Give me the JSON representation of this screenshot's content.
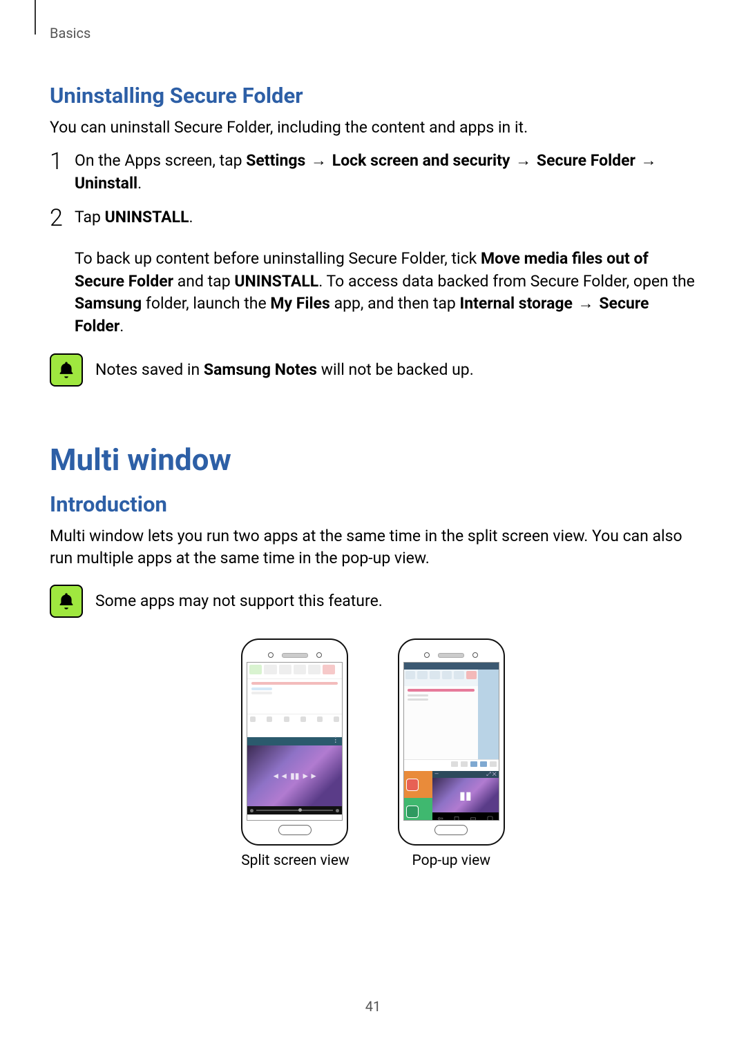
{
  "header": {
    "section_label": "Basics"
  },
  "section1": {
    "heading": "Uninstalling Secure Folder",
    "intro": "You can uninstall Secure Folder, including the content and apps in it.",
    "step1": {
      "num": "1",
      "t1": "On the Apps screen, tap",
      "b1": "Settings",
      "arrow": "→",
      "b2": "Lock screen and security",
      "b3": "Secure Folder",
      "b4": "Uninstall",
      "period": "."
    },
    "step2": {
      "num": "2",
      "t1": "Tap",
      "b1": "UNINSTALL",
      "period": ".",
      "p2a": "To back up content before uninstalling Secure Folder, tick",
      "p2b": "Move media files out of Secure Folder",
      "p2c": "and tap",
      "p2d": "UNINSTALL",
      "p2e": ". To access data backed from Secure Folder, open the",
      "p2f": "Samsung",
      "p2g": "folder, launch the",
      "p2h": "My Files",
      "p2i": "app, and then tap",
      "p2j": "Internal storage",
      "p2k": "Secure Folder",
      "p2l": "."
    },
    "note": {
      "t1": "Notes saved in",
      "b1": "Samsung Notes",
      "t2": "will not be backed up."
    }
  },
  "section2": {
    "chapter": "Multi window",
    "sub_heading": "Introduction",
    "intro": "Multi window lets you run two apps at the same time in the split screen view. You can also run multiple apps at the same time in the pop-up view.",
    "note": "Some apps may not support this feature.",
    "fig1_caption": "Split screen view",
    "fig2_caption": "Pop-up view"
  },
  "page_number": "41"
}
